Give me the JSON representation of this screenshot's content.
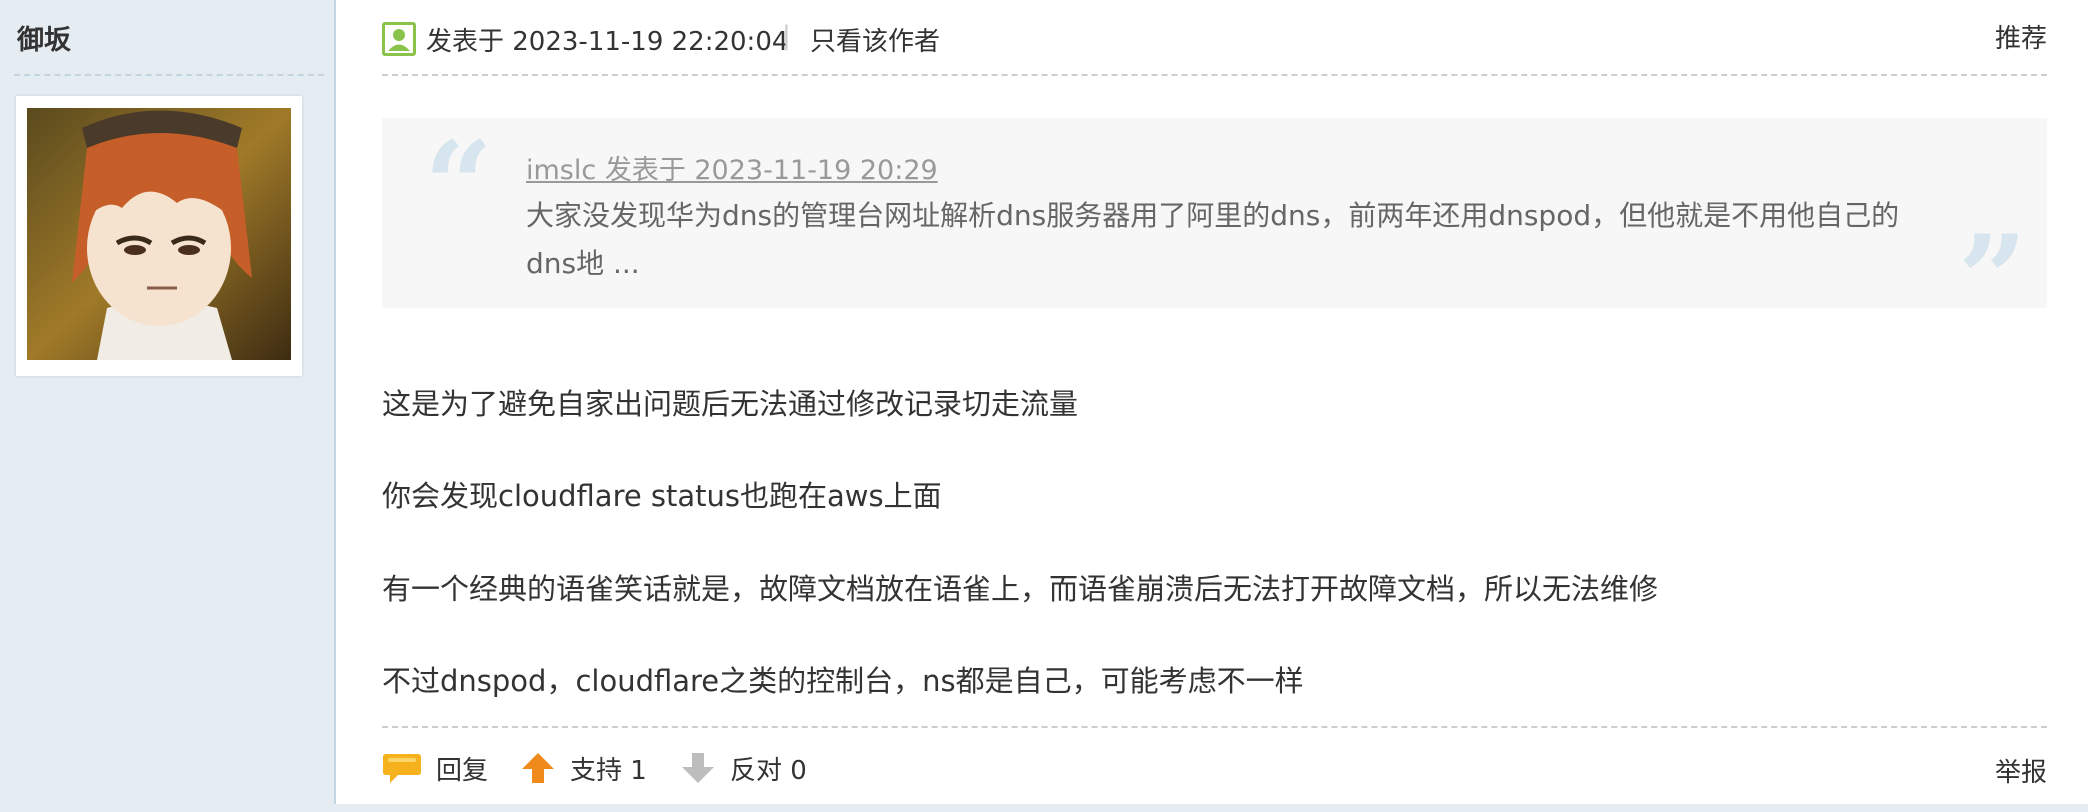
{
  "author": {
    "name": "御坂"
  },
  "post": {
    "posted_at": "发表于 2023-11-19 22:20:04",
    "separator": "|",
    "only_author_label": "只看该作者",
    "recommend_label": "推荐"
  },
  "quote": {
    "source": "imslc 发表于 2023-11-19 20:29",
    "text": "大家没发现华为dns的管理台网址解析dns服务器用了阿里的dns，前两年还用dnspod，但他就是不用他自己的dns地 ..."
  },
  "body": {
    "paragraphs": [
      "这是为了避免自家出问题后无法通过修改记录切走流量",
      "你会发现cloudflare status也跑在aws上面",
      "有一个经典的语雀笑话就是，故障文档放在语雀上，而语雀崩溃后无法打开故障文档，所以无法维修",
      "不过dnspod，cloudflare之类的控制台，ns都是自己，可能考虑不一样"
    ]
  },
  "footer": {
    "reply_label": "回复",
    "support_label": "支持 1",
    "oppose_label": "反对 0",
    "report_label": "举报"
  },
  "colors": {
    "sidebar_bg": "#e5edf2",
    "quote_bg": "#f7f7f7",
    "quote_mark": "#d7e5ef",
    "support_arrow": "#f08a1c",
    "oppose_arrow": "#bdbdbd",
    "reply_icon": "#f5b21c",
    "online_icon": "#8bc34a"
  },
  "icons": [
    "user-online-icon",
    "avatar",
    "reply-bubble-icon",
    "support-arrow-icon",
    "oppose-arrow-icon"
  ]
}
